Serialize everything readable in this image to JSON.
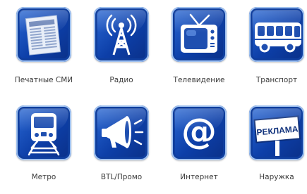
{
  "tiles": [
    {
      "label": "Печатные СМИ",
      "icon": "newspaper-icon"
    },
    {
      "label": "Радио",
      "icon": "radio-tower-icon"
    },
    {
      "label": "Телевидение",
      "icon": "tv-icon"
    },
    {
      "label": "Транспорт",
      "icon": "bus-icon"
    },
    {
      "label": "Метро",
      "icon": "metro-train-icon"
    },
    {
      "label": "BTL/Промо",
      "icon": "megaphone-icon"
    },
    {
      "label": "Интернет",
      "icon": "at-sign-icon"
    },
    {
      "label": "Наружка",
      "icon": "billboard-icon",
      "sign_text": "РЕКЛАМА"
    }
  ]
}
